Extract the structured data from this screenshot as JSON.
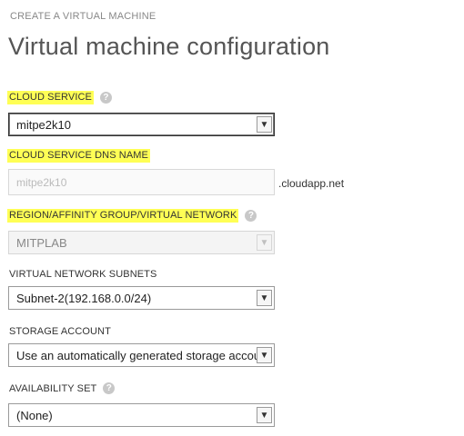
{
  "header": {
    "wizard_label": "CREATE A VIRTUAL MACHINE",
    "page_title": "Virtual machine configuration"
  },
  "form": {
    "cloud_service": {
      "label": "CLOUD SERVICE",
      "value": "mitpe2k10"
    },
    "dns_name": {
      "label": "CLOUD SERVICE DNS NAME",
      "value": "mitpe2k10",
      "suffix": ".cloudapp.net"
    },
    "region": {
      "label": "REGION/AFFINITY GROUP/VIRTUAL NETWORK",
      "value": "MITPLAB"
    },
    "subnets": {
      "label": "VIRTUAL NETWORK SUBNETS",
      "value": "Subnet-2(192.168.0.0/24)"
    },
    "storage": {
      "label": "STORAGE ACCOUNT",
      "value": "Use an automatically generated storage account"
    },
    "availability": {
      "label": "AVAILABILITY SET",
      "value": "(None)"
    }
  },
  "icons": {
    "help": "?",
    "dropdown": "▼"
  },
  "colors": {
    "highlight": "#ffff55"
  }
}
